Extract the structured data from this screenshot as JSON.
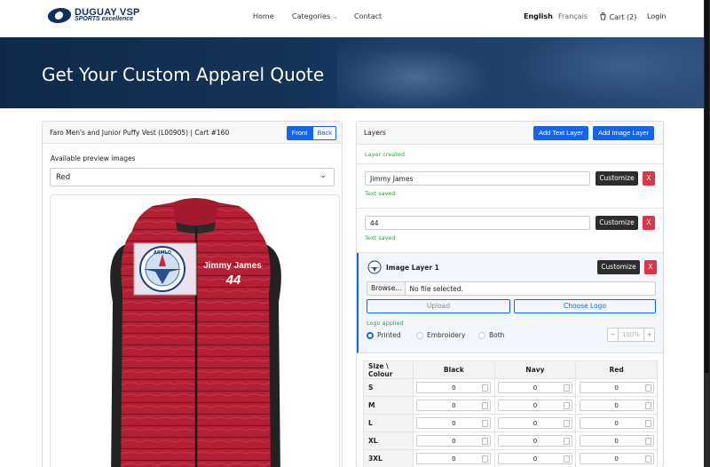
{
  "nav": {
    "logo_main": "DUGUAY VSP",
    "logo_sub": "SPORTS excellence",
    "home": "Home",
    "categories": "Categories",
    "contact": "Contact",
    "english": "English",
    "francais": "Français",
    "cart": "Cart (2)",
    "login": "Login"
  },
  "hero": {
    "title": "Get Your Custom Apparel Quote"
  },
  "product": {
    "title": "Faro Men's and Junior Puffy Vest (L00905) | Cart #160",
    "front": "Front",
    "back": "Back",
    "preview_label": "Available preview images",
    "selected_color": "Red",
    "vest_name": "Jimmy James",
    "vest_number": "44",
    "logo_text": "ARMLO"
  },
  "layers": {
    "title": "Layers",
    "add_text": "Add Text Layer",
    "add_image": "Add Image Layer",
    "created_msg": "Layer created",
    "text_layer_1": {
      "value": "Jimmy James",
      "customize": "Customize",
      "remove": "X",
      "status": "Text saved"
    },
    "text_layer_2": {
      "value": "44",
      "customize": "Customize",
      "remove": "X",
      "status": "Text saved"
    },
    "image_layer": {
      "title": "Image Layer 1",
      "customize": "Customize",
      "remove": "X",
      "browse": "Browse...",
      "no_file": "No file selected.",
      "upload": "Upload",
      "choose_logo": "Choose Logo",
      "status": "Logo applied",
      "options": [
        "Printed",
        "Embroidery",
        "Both"
      ],
      "selected_option": "Printed",
      "zoom_minus": "−",
      "zoom": "100%",
      "zoom_plus": "+"
    }
  },
  "size_table": {
    "corner": "Size \\ Colour",
    "colors": [
      "Black",
      "Navy",
      "Red"
    ],
    "sizes": [
      "S",
      "M",
      "L",
      "XL",
      "3XL"
    ],
    "default_qty": "0"
  },
  "colors": {
    "accent": "#1565e8",
    "danger": "#dc3545",
    "dark": "#2d2d2d",
    "vest": "#b41f35",
    "success": "#28a745"
  }
}
